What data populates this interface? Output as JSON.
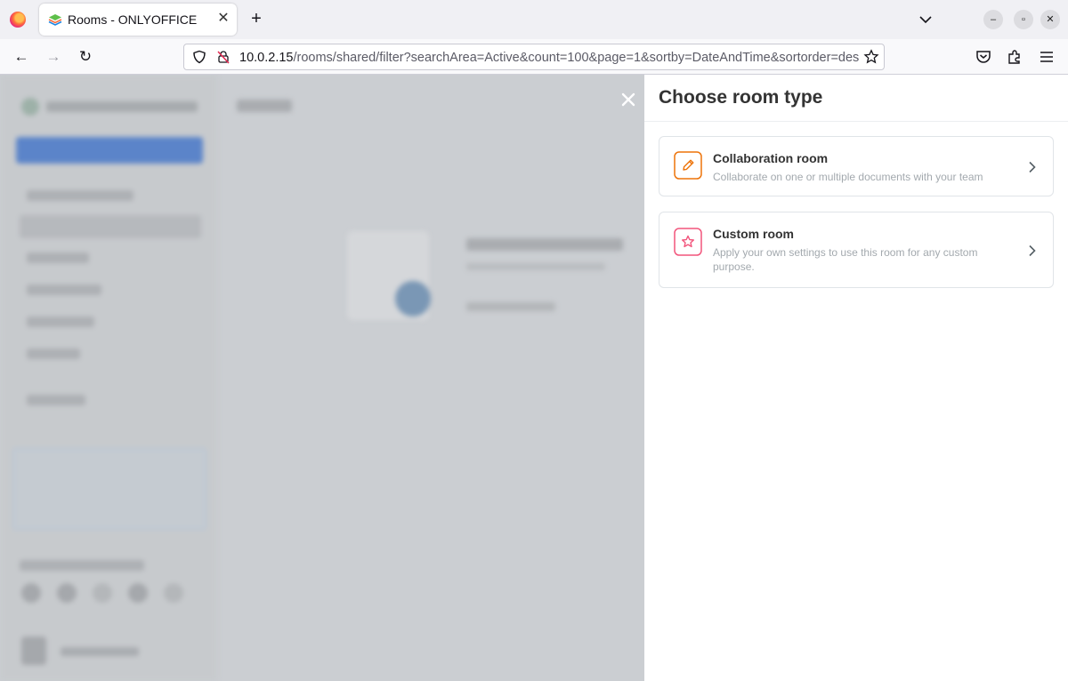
{
  "browser": {
    "tab_title": "Rooms - ONLYOFFICE",
    "url_host": "10.0.2.15",
    "url_path": "/rooms/shared/filter?searchArea=Active&count=100&page=1&sortby=DateAndTime&sortorder=descending"
  },
  "panel": {
    "title": "Choose room type",
    "rooms": [
      {
        "name": "Collaboration room",
        "description": "Collaborate on one or multiple documents with your team",
        "icon": "pencil-icon",
        "color": "#ed7309"
      },
      {
        "name": "Custom room",
        "description": "Apply your own settings to use this room for any custom purpose.",
        "icon": "star-icon",
        "color": "#f2557c"
      }
    ]
  },
  "colors": {
    "overlay": "#cbced2",
    "panel_bg": "#ffffff"
  }
}
